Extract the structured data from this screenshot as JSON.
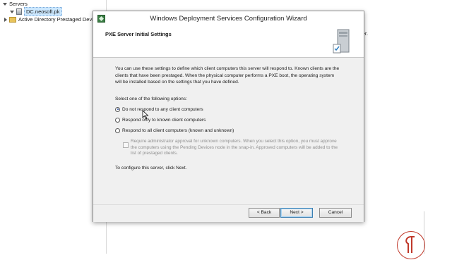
{
  "background": {
    "tree_items": [
      {
        "label": "Servers"
      },
      {
        "label": "DC.neosoft.pk"
      },
      {
        "label": "Active Directory Prestaged Devi"
      }
    ],
    "right_text": "ver."
  },
  "wizard": {
    "title": "Windows Deployment Services Configuration Wizard",
    "header_title": "PXE Server Initial Settings",
    "description": "You can use these settings to define which client computers this server will respond to. Known clients are the clients that have been prestaged. When the physical computer performs a PXE boot, the operating system will be installed based on the settings that you have defined.",
    "prompt": "Select one of the following options:",
    "options": [
      {
        "label": "Do not respond to any client computers",
        "selected": true
      },
      {
        "label": "Respond only to known client computers",
        "selected": false
      },
      {
        "label": "Respond to all client computers (known and unknown)",
        "selected": false
      }
    ],
    "approval_checkbox": {
      "label": "Require administrator approval for unknown computers. When you select this option, you must approve the computers using the Pending Devices node in the snap-in. Approved computers will be added to the list of prestaged clients.",
      "checked": false,
      "enabled": false
    },
    "footer_note": "To configure this server, click Next.",
    "buttons": {
      "back": "< Back",
      "next": "Next >",
      "cancel": "Cancel"
    }
  },
  "colors": {
    "selection": "#cce8ff",
    "dialog_body": "#f0f0f0",
    "default_button_border": "#3c7fb1",
    "logo": "#c0392b"
  },
  "icons": [
    "server-icon",
    "folder-icon",
    "wds-app-icon",
    "server-tower-icon",
    "mouse-cursor-icon",
    "logo-icon"
  ]
}
